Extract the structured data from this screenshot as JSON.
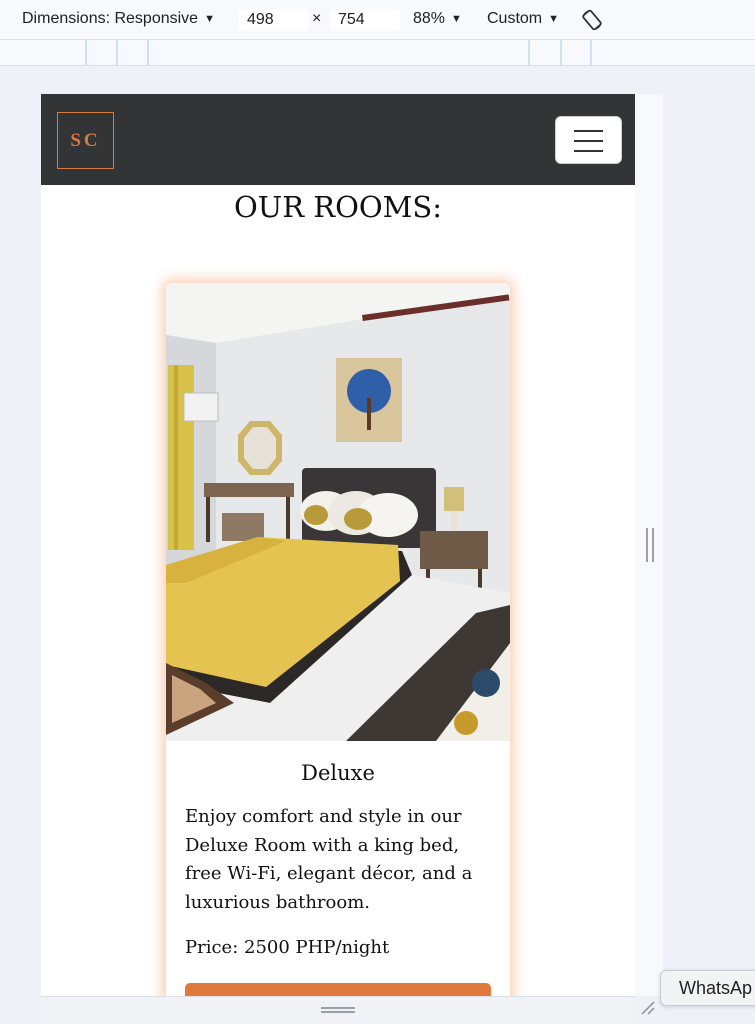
{
  "devtools": {
    "dimensions_label": "Dimensions: Responsive",
    "width_value": "498",
    "times": "×",
    "height_value": "754",
    "zoom": "88%",
    "throttle": "Custom",
    "rotate_icon": "rotate-icon",
    "caret": "▼"
  },
  "site": {
    "logo_text": "SC",
    "menu_icon": "hamburger-icon",
    "section_title": "OUR ROOMS:"
  },
  "room": {
    "name": "Deluxe",
    "description": "Enjoy comfort and style in our Deluxe Room with a king bed, free Wi-Fi, elegant décor, and a luxurious bathroom.",
    "price": "Price: 2500 PHP/night"
  },
  "tooltip": {
    "text": "WhatsAp"
  },
  "colors": {
    "navbar": "#333435",
    "accent": "#e07a3c",
    "card_glow": "#f0965a"
  }
}
